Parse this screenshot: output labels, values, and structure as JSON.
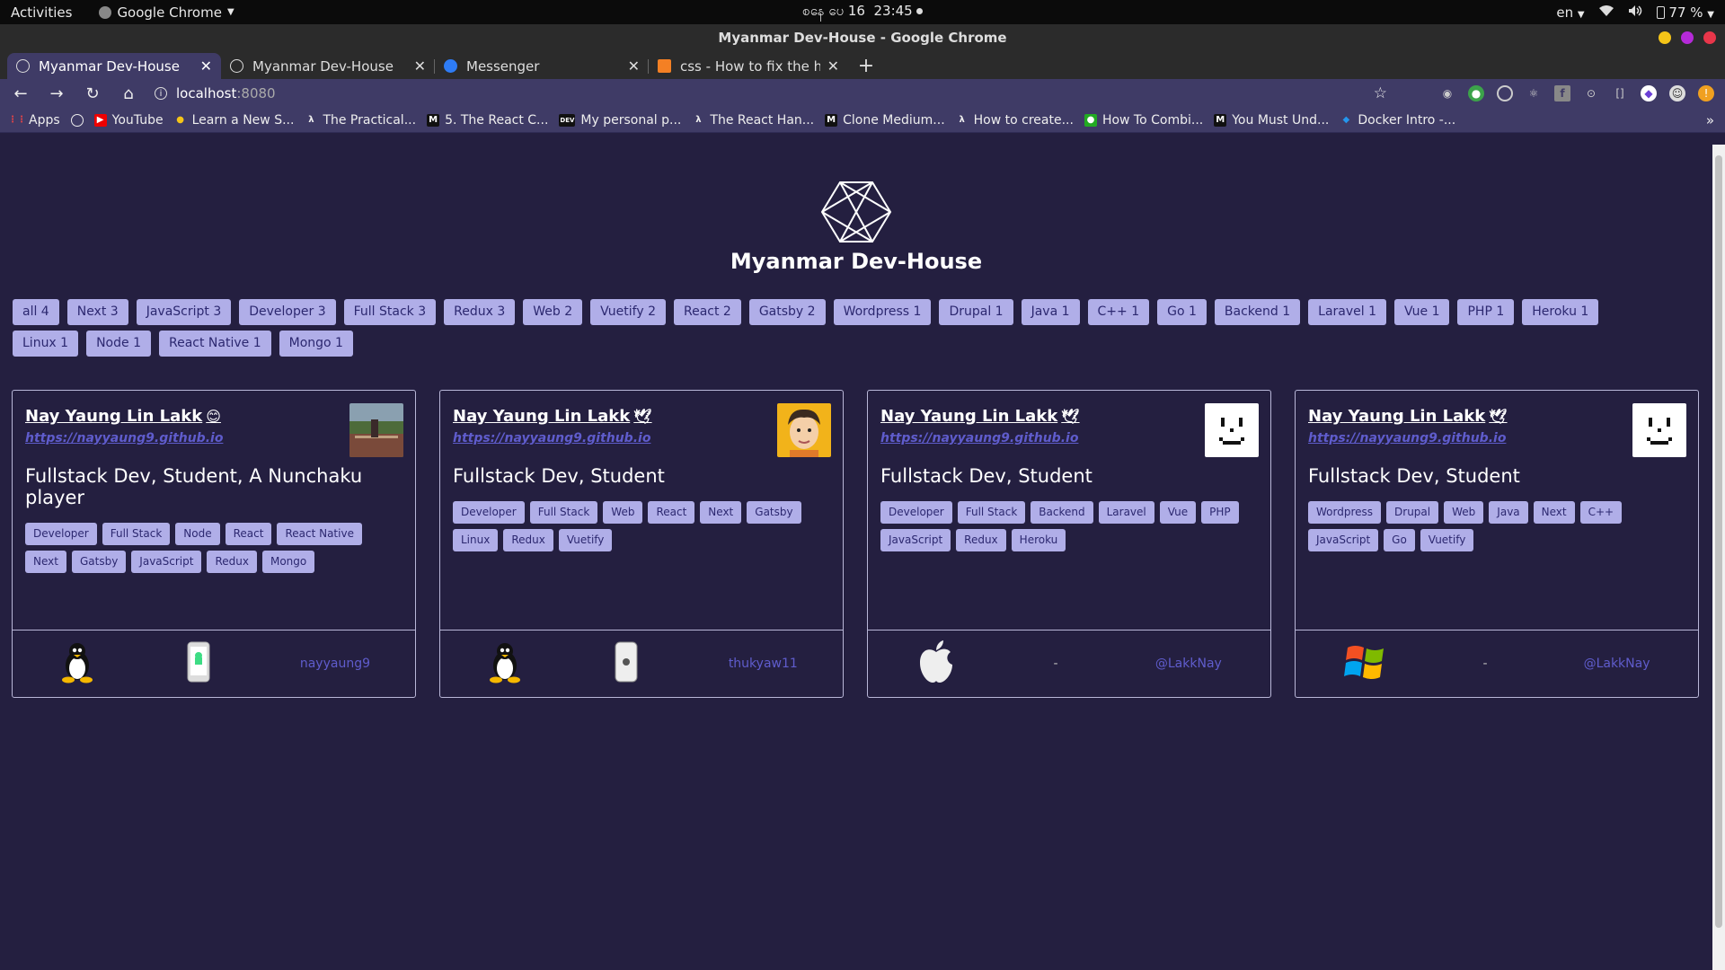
{
  "system": {
    "activities": "Activities",
    "app_name": "Google Chrome",
    "clock_date": "စနေ ပေ 16",
    "clock_time": "23:45",
    "lang": "en",
    "battery": "77 %"
  },
  "window": {
    "title": "Myanmar Dev-House - Google Chrome"
  },
  "tabs": [
    {
      "label": "Myanmar Dev-House",
      "active": true
    },
    {
      "label": "Myanmar Dev-House",
      "active": false
    },
    {
      "label": "Messenger",
      "active": false
    },
    {
      "label": "css - How to fix the height",
      "active": false
    }
  ],
  "toolbar": {
    "host": "localhost",
    "port": ":8080"
  },
  "bookmarks": [
    "Apps",
    "",
    "YouTube",
    "Learn a New S...",
    "The Practical...",
    "5. The React C...",
    "My personal p...",
    "The React Han...",
    "Clone Medium...",
    "How to create...",
    "How To Combi...",
    "You Must Und...",
    "Docker Intro -..."
  ],
  "bookmark_more": "»",
  "site": {
    "title": "Myanmar Dev-House"
  },
  "filters": [
    "all 4",
    "Next 3",
    "JavaScript 3",
    "Developer 3",
    "Full Stack 3",
    "Redux 3",
    "Web 2",
    "Vuetify 2",
    "React 2",
    "Gatsby 2",
    "Wordpress 1",
    "Drupal 1",
    "Java 1",
    "C++ 1",
    "Go 1",
    "Backend 1",
    "Laravel 1",
    "Vue 1",
    "PHP 1",
    "Heroku 1",
    "Linux 1",
    "Node 1",
    "React Native 1",
    "Mongo 1"
  ],
  "cards": [
    {
      "name": "Nay Yaung Lin Lakk",
      "emoji": "😊",
      "url": "https://nayyaung9.github.io",
      "bio": "Fullstack Dev, Student, A Nunchaku player",
      "tags": [
        "Developer",
        "Full Stack",
        "Node",
        "React",
        "React Native",
        "Next",
        "Gatsby",
        "JavaScript",
        "Redux",
        "Mongo"
      ],
      "os": "linux-icon",
      "phone": "android-phone-icon",
      "handle": "nayyaung9",
      "avatar": "photo"
    },
    {
      "name": "Nay Yaung Lin Lakk",
      "emoji": "🕊",
      "url": "https://nayyaung9.github.io",
      "bio": "Fullstack Dev, Student",
      "tags": [
        "Developer",
        "Full Stack",
        "Web",
        "React",
        "Next",
        "Gatsby",
        "Linux",
        "Redux",
        "Vuetify"
      ],
      "os": "linux-icon",
      "phone": "iphone-icon",
      "handle": "thukyaw11",
      "avatar": "cartoon"
    },
    {
      "name": "Nay Yaung Lin Lakk",
      "emoji": "🕊",
      "url": "https://nayyaung9.github.io",
      "bio": "Fullstack Dev, Student",
      "tags": [
        "Developer",
        "Full Stack",
        "Backend",
        "Laravel",
        "Vue",
        "PHP",
        "JavaScript",
        "Redux",
        "Heroku"
      ],
      "os": "apple-icon",
      "phone": "-",
      "handle": "@LakkNay",
      "avatar": "face"
    },
    {
      "name": "Nay Yaung Lin Lakk",
      "emoji": "🕊",
      "url": "https://nayyaung9.github.io",
      "bio": "Fullstack Dev, Student",
      "tags": [
        "Wordpress",
        "Drupal",
        "Web",
        "Java",
        "Next",
        "C++",
        "JavaScript",
        "Go",
        "Vuetify"
      ],
      "os": "windows-icon",
      "phone": "-",
      "handle": "@LakkNay",
      "avatar": "face"
    }
  ],
  "colors": {
    "page_bg": "#241f40",
    "chip_bg": "#b0aee8",
    "chip_text": "#2c2870",
    "link": "#5f5ccc"
  }
}
